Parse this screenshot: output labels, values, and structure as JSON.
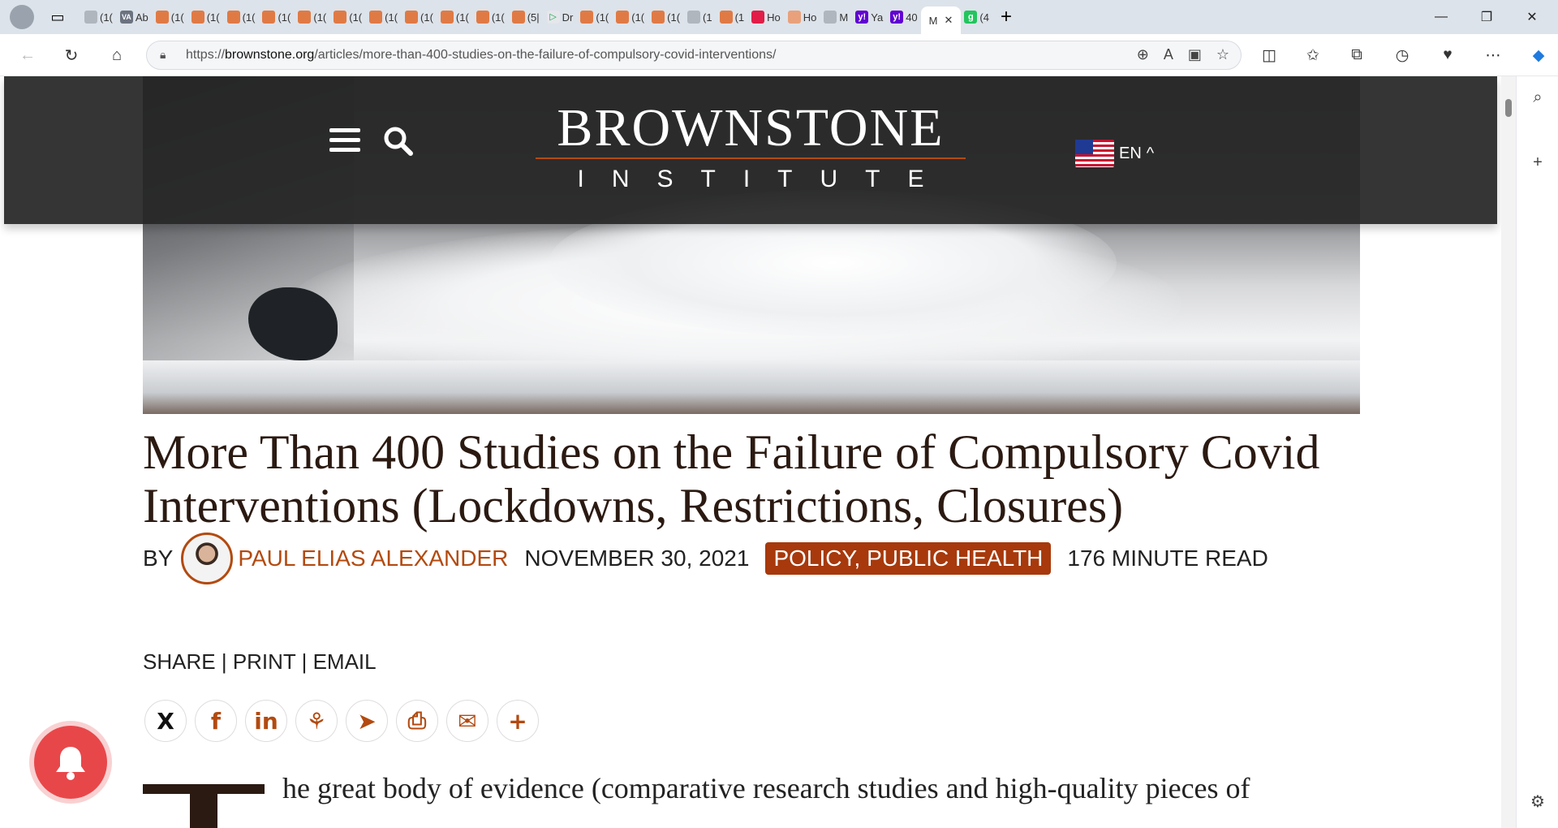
{
  "browser": {
    "tabs": [
      {
        "label": "(1(",
        "icon": "bookmark-icon"
      },
      {
        "label": "Ab",
        "icon": "va-icon"
      },
      {
        "label": "(1(",
        "icon": "brownstone-icon"
      },
      {
        "label": "(1(",
        "icon": "brownstone-icon"
      },
      {
        "label": "(1(",
        "icon": "brownstone-icon"
      },
      {
        "label": "(1(",
        "icon": "brownstone-icon"
      },
      {
        "label": "(1(",
        "icon": "brownstone-icon"
      },
      {
        "label": "(1(",
        "icon": "brownstone-icon"
      },
      {
        "label": "(1(",
        "icon": "brownstone-icon"
      },
      {
        "label": "(1(",
        "icon": "brownstone-icon"
      },
      {
        "label": "(1(",
        "icon": "brownstone-icon"
      },
      {
        "label": "(1(",
        "icon": "brownstone-icon"
      },
      {
        "label": "(5|",
        "icon": "brownstone-icon"
      },
      {
        "label": "Dr",
        "icon": "play-icon"
      },
      {
        "label": "(1(",
        "icon": "brownstone-icon"
      },
      {
        "label": "(1(",
        "icon": "brownstone-icon"
      },
      {
        "label": "(1(",
        "icon": "brownstone-icon"
      },
      {
        "label": "(1",
        "icon": "photo-icon"
      },
      {
        "label": "(1",
        "icon": "brownstone-icon"
      },
      {
        "label": "Ho",
        "icon": "red-icon"
      },
      {
        "label": "Ho",
        "icon": "pink-icon"
      },
      {
        "label": "M",
        "icon": "search-icon"
      },
      {
        "label": "Ya",
        "icon": "yahoo-icon"
      },
      {
        "label": "40",
        "icon": "yahoo-icon"
      }
    ],
    "active_tab": {
      "label": "M",
      "close": "✕"
    },
    "extra_tab": {
      "label": "(4",
      "icon": "grammarly-icon"
    },
    "new_tab": "+",
    "window": {
      "minimize": "—",
      "restore": "❐",
      "close": "✕"
    },
    "url_prefix": "https://",
    "url_host": "brownstone.org",
    "url_path": "/articles/more-than-400-studies-on-the-failure-of-compulsory-covid-interventions/"
  },
  "site": {
    "logo_top": "BROWNSTONE",
    "logo_bottom": "INSTITUTE",
    "lang": "EN",
    "lang_arrow": "^"
  },
  "article": {
    "title": "More Than 400 Studies on the Failure of Compulsory Covid Interventions (Lockdowns, Restrictions, Closures)",
    "by": "BY",
    "author": "PAUL ELIAS ALEXANDER",
    "date": "NOVEMBER 30, 2021",
    "categories": "POLICY, PUBLIC HEALTH",
    "read_time": "176 MINUTE READ",
    "share": "SHARE",
    "print": "PRINT",
    "email": "EMAIL",
    "sep": "|",
    "share_buttons": [
      "X",
      "f",
      "in",
      "⚘",
      "➤",
      "⎙",
      "✉",
      "+"
    ],
    "body_first_line": "he great body of evidence (comparative research studies and high-quality pieces of",
    "dropcap": "T"
  },
  "colors": {
    "accent": "#b34a10",
    "category_bg": "#a7390c",
    "title": "#2b1a12",
    "header": "#262626"
  }
}
